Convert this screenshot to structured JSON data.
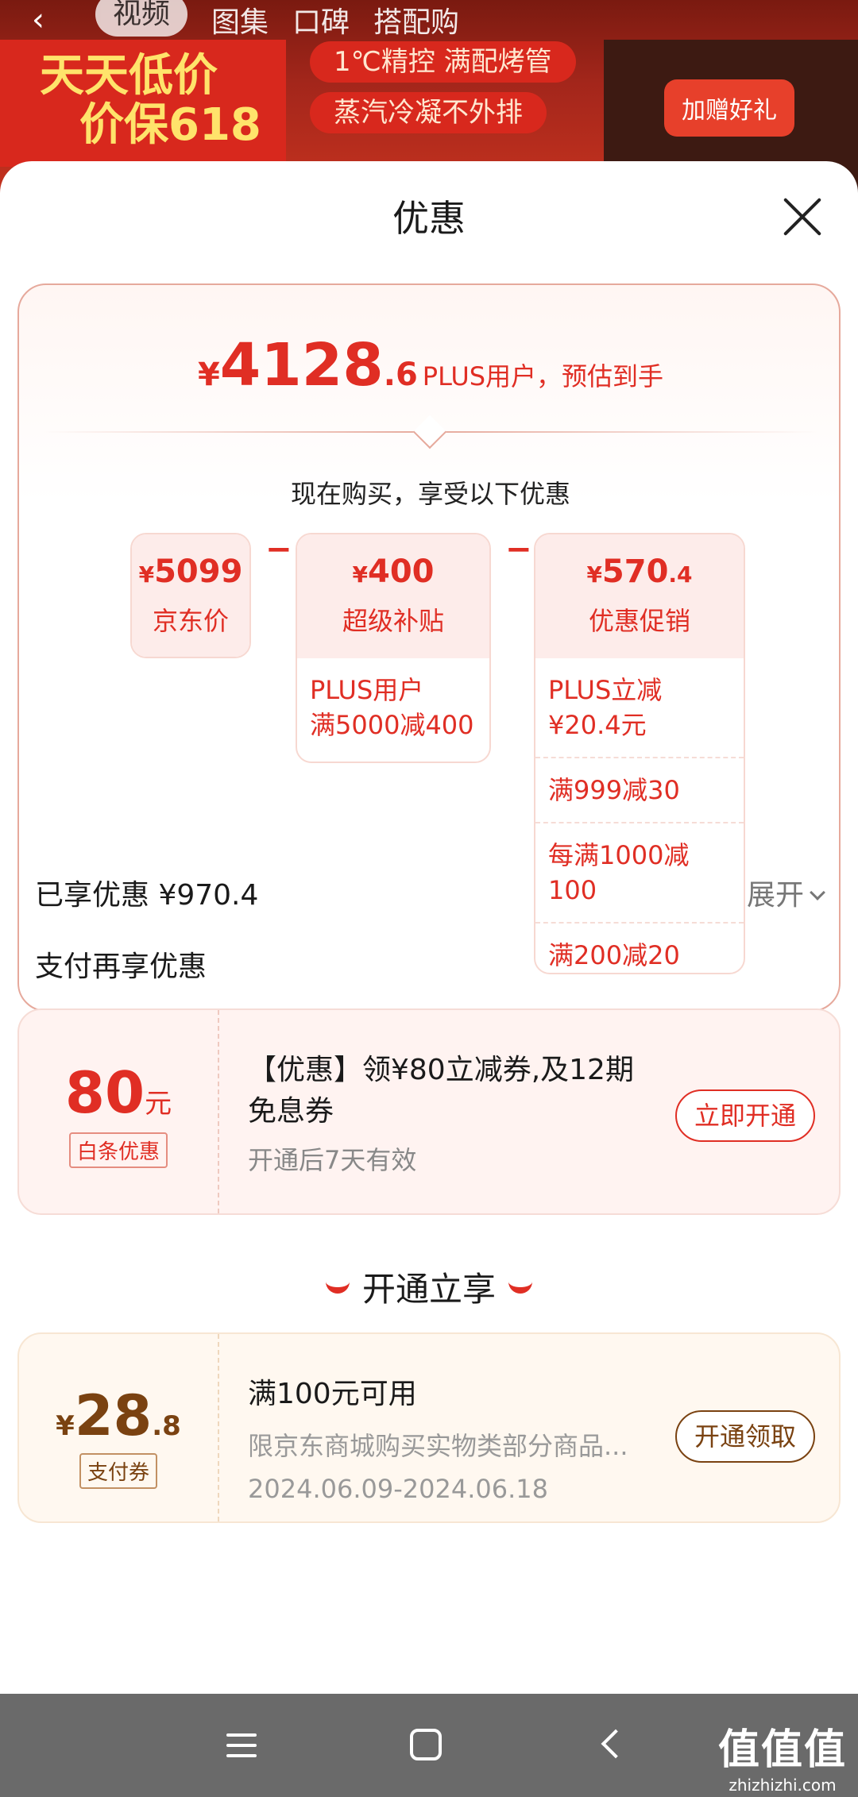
{
  "bg": {
    "tabs": [
      "视频",
      "图集",
      "口碑",
      "搭配购"
    ],
    "active_tab": "视频",
    "promo_line1": "天天低价",
    "promo_line2": "价保618",
    "pill1": "1℃精控 满配烤管",
    "pill2": "蒸汽冷凝不外排",
    "gift": "加赠好礼"
  },
  "sheet": {
    "title": "优惠",
    "estimate": {
      "yen": "¥",
      "integer": "4128",
      "decimal": ".6",
      "label": "PLUS用户，预估到手"
    },
    "buy_note": "现在购买，享受以下优惠",
    "boxes": [
      {
        "value": "5099",
        "name": "京东价",
        "rows": []
      },
      {
        "value": "400",
        "name": "超级补贴",
        "rows": [
          "PLUS用户\n满5000减400"
        ]
      },
      {
        "value": "570",
        "value_dec": ".4",
        "name": "优惠促销",
        "rows": [
          "PLUS立减\n¥20.4元",
          "满999减30",
          "每满1000减100",
          "满200减20"
        ]
      }
    ],
    "operator_minus": "−",
    "enjoyed": "已享优惠 ¥970.4",
    "expand_label": "展开",
    "pay_more_title": "支付再享优惠",
    "coupon1": {
      "amount": "80",
      "unit": "元",
      "tag": "白条优惠",
      "title": "【优惠】领¥80立减券,及12期免息券",
      "subtitle": "开通后7天有效",
      "button": "立即开通"
    },
    "open_now": "开通立享",
    "coupon2": {
      "yen": "¥",
      "integer": "28",
      "decimal": ".8",
      "tag": "支付券",
      "title": "满100元可用",
      "subtitle": "限京东商城购买实物类部分商品...",
      "date_range": "2024.06.09-2024.06.18",
      "button": "开通领取"
    }
  },
  "watermark": {
    "cn": "值值值",
    "domain": "zhizhizhi.com"
  },
  "colors": {
    "accent": "#e02e24",
    "brown": "#7a4211"
  }
}
